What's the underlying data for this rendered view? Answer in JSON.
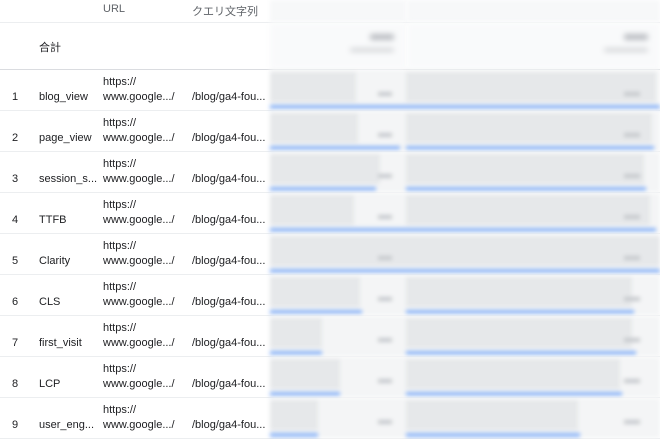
{
  "header": {
    "url": "URL",
    "query": "クエリ文字列"
  },
  "total": {
    "label": "合計"
  },
  "rows": [
    {
      "index": "1",
      "event": "blog_view",
      "url_line1": "https://",
      "url_line2": "www.google.../",
      "query": "/blog/ga4-fou..."
    },
    {
      "index": "2",
      "event": "page_view",
      "url_line1": "https://",
      "url_line2": "www.google.../",
      "query": "/blog/ga4-fou..."
    },
    {
      "index": "3",
      "event": "session_s...",
      "url_line1": "https://",
      "url_line2": "www.google.../",
      "query": "/blog/ga4-fou..."
    },
    {
      "index": "4",
      "event": "TTFB",
      "url_line1": "https://",
      "url_line2": "www.google.../",
      "query": "/blog/ga4-fou..."
    },
    {
      "index": "5",
      "event": "Clarity",
      "url_line1": "https://",
      "url_line2": "www.google.../",
      "query": "/blog/ga4-fou..."
    },
    {
      "index": "6",
      "event": "CLS",
      "url_line1": "https://",
      "url_line2": "www.google.../",
      "query": "/blog/ga4-fou..."
    },
    {
      "index": "7",
      "event": "first_visit",
      "url_line1": "https://",
      "url_line2": "www.google.../",
      "query": "/blog/ga4-fou..."
    },
    {
      "index": "8",
      "event": "LCP",
      "url_line1": "https://",
      "url_line2": "www.google.../",
      "query": "/blog/ga4-fou..."
    },
    {
      "index": "9",
      "event": "user_eng...",
      "url_line1": "https://",
      "url_line2": "www.google.../",
      "query": "/blog/ga4-fou..."
    }
  ]
}
